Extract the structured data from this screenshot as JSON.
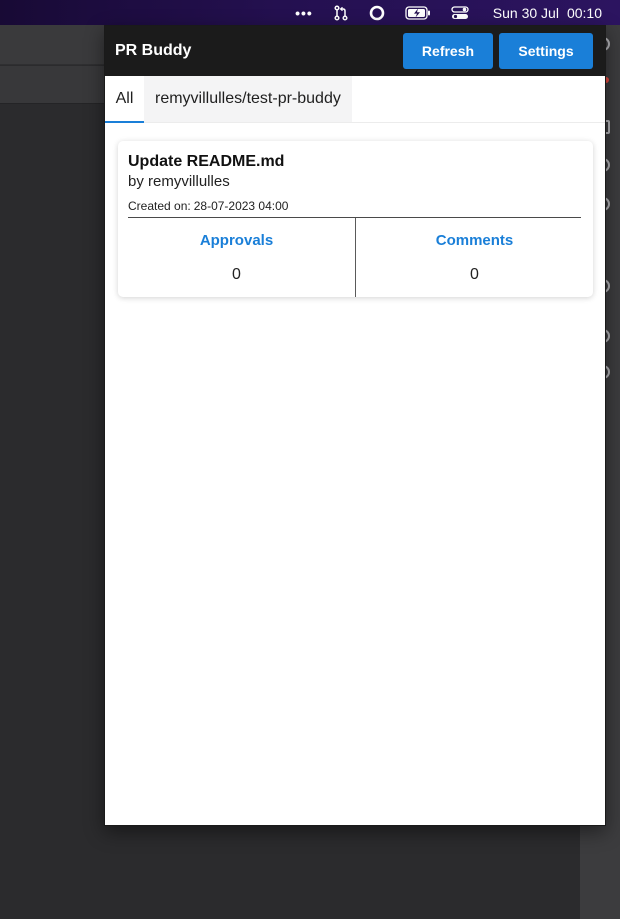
{
  "menubar": {
    "date": "Sun 30 Jul",
    "time": "00:10",
    "icons": [
      "more-dots-icon",
      "git-pull-request-icon",
      "record-circle-icon",
      "battery-charging-icon",
      "control-center-icon"
    ]
  },
  "app": {
    "title": "PR Buddy",
    "refresh_label": "Refresh",
    "settings_label": "Settings",
    "accent_color": "#1a7fd8"
  },
  "tabs": [
    {
      "label": "All",
      "selected": true
    },
    {
      "label": "remyvillulles/test-pr-buddy",
      "selected": false
    }
  ],
  "pull_requests": [
    {
      "title": "Update README.md",
      "author": "by remyvillulles",
      "created_label": "Created on:",
      "created_value": "28-07-2023 04:00",
      "approvals_label": "Approvals",
      "approvals_value": "0",
      "comments_label": "Comments",
      "comments_value": "0"
    }
  ]
}
